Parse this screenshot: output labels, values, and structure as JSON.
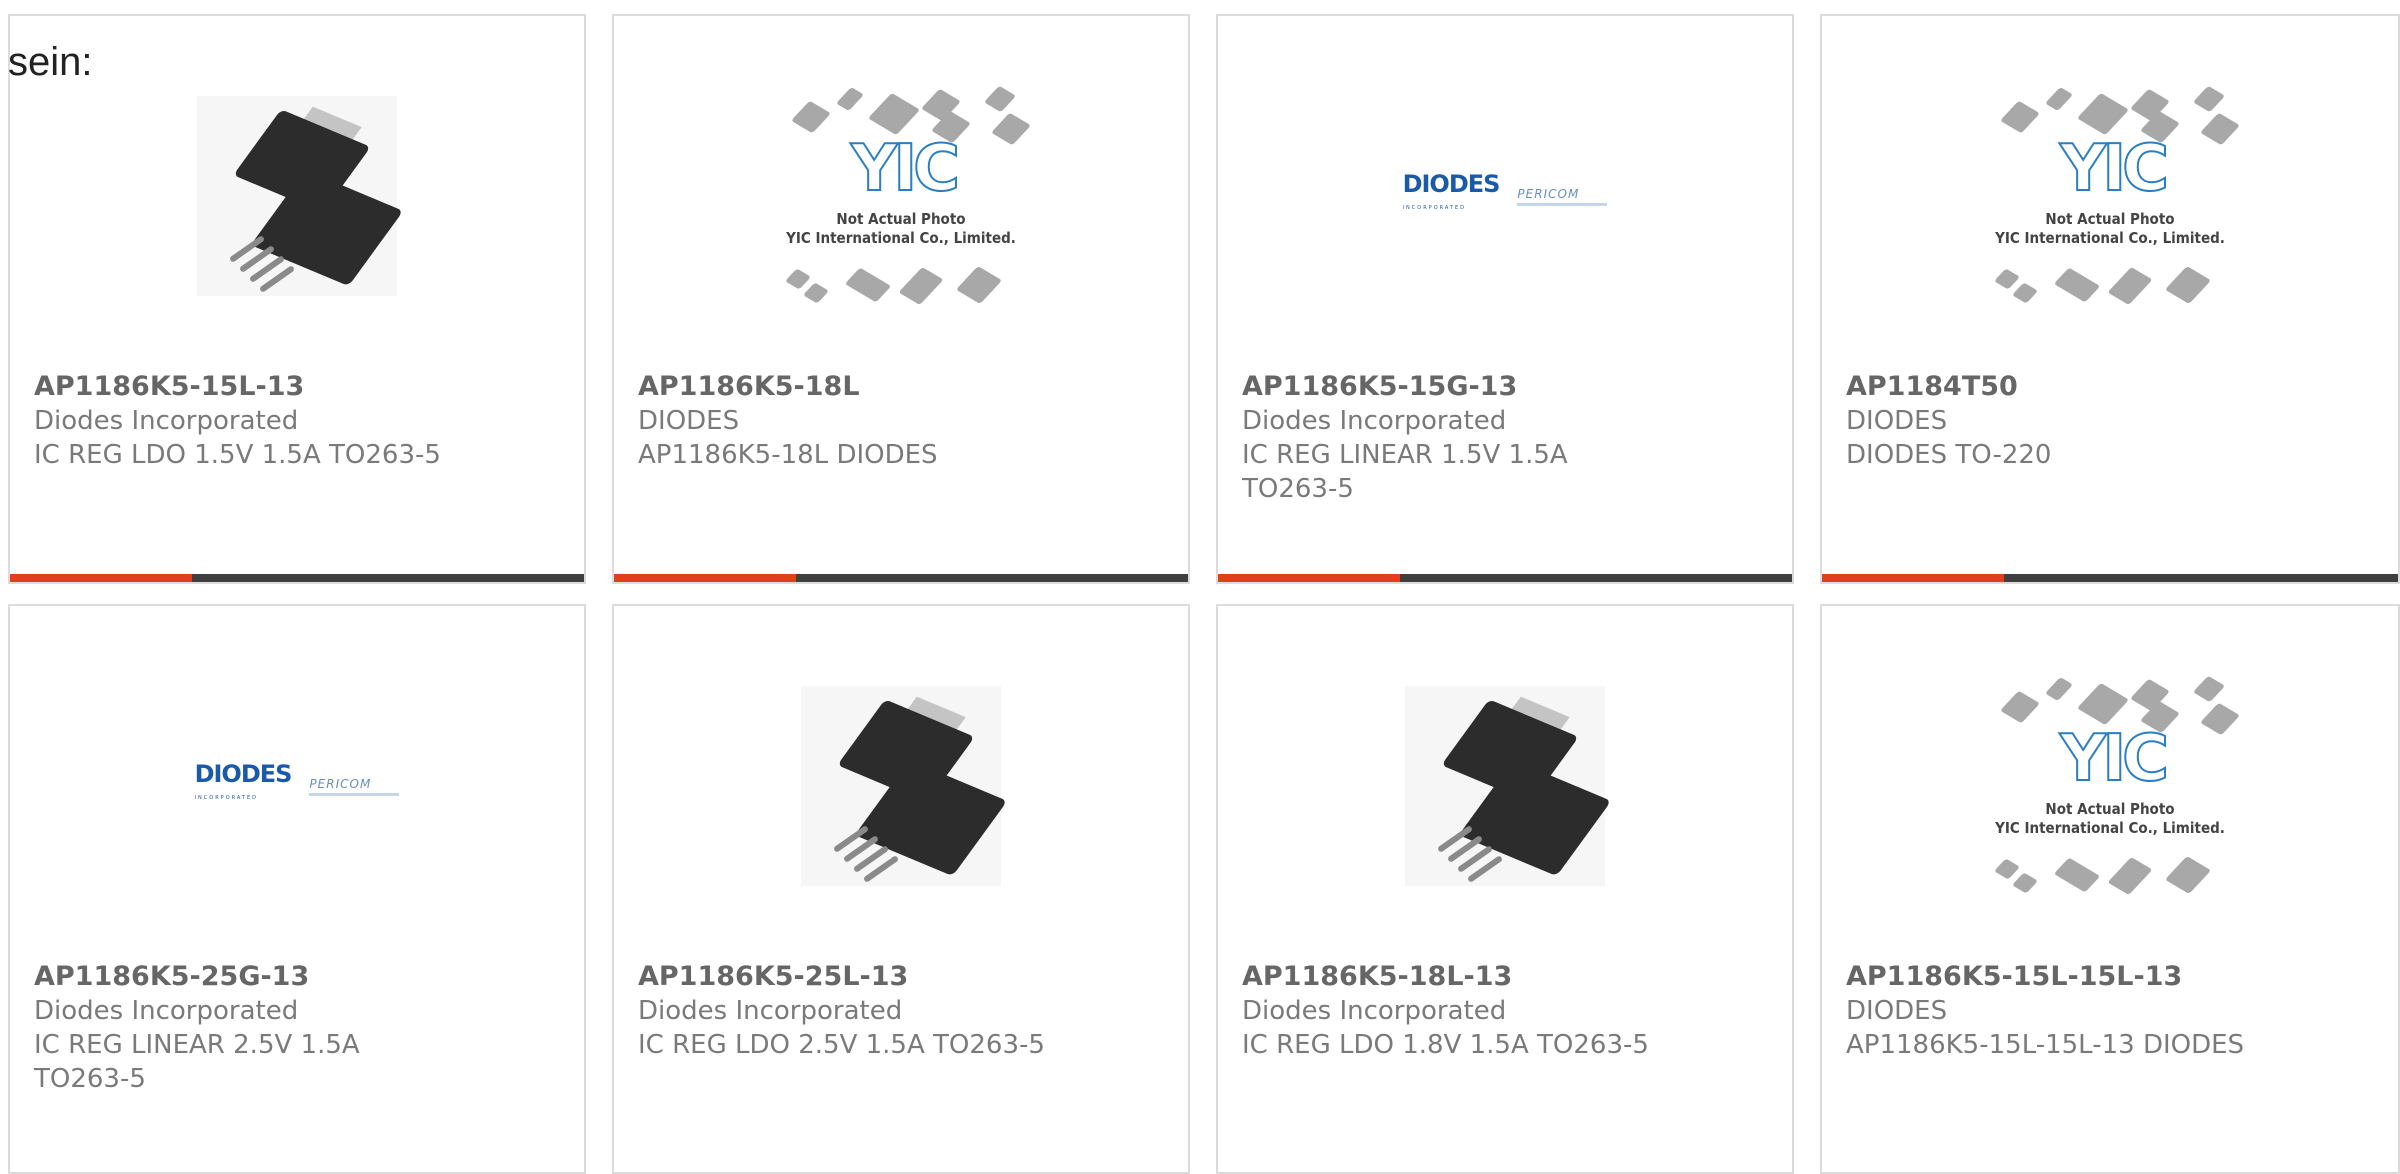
{
  "lead_text": "sein:",
  "products": [
    {
      "part": "AP1186K5-15L-13",
      "manufacturer": "Diodes Incorporated",
      "description": "IC REG LDO 1.5V 1.5A TO263-5",
      "image": "chip-package-photo"
    },
    {
      "part": "AP1186K5-18L",
      "manufacturer": "DIODES",
      "description": "AP1186K5-18L DIODES",
      "image": "yic-placeholder"
    },
    {
      "part": "AP1186K5-15G-13",
      "manufacturer": "Diodes Incorporated",
      "description": "IC REG LINEAR 1.5V 1.5A TO263-5",
      "image": "diodes-logo"
    },
    {
      "part": "AP1184T50",
      "manufacturer": "DIODES",
      "description": "DIODES TO-220",
      "image": "yic-placeholder"
    },
    {
      "part": "AP1186K5-25G-13",
      "manufacturer": "Diodes Incorporated",
      "description": "IC REG LINEAR 2.5V 1.5A TO263-5",
      "image": "diodes-logo"
    },
    {
      "part": "AP1186K5-25L-13",
      "manufacturer": "Diodes Incorporated",
      "description": "IC REG LDO 2.5V 1.5A TO263-5",
      "image": "chip-package-photo"
    },
    {
      "part": "AP1186K5-18L-13",
      "manufacturer": "Diodes Incorporated",
      "description": "IC REG LDO 1.8V 1.5A TO263-5",
      "image": "chip-package-photo"
    },
    {
      "part": "AP1186K5-15L-15L-13",
      "manufacturer": "DIODES",
      "description": "AP1186K5-15L-15L-13 DIODES",
      "image": "yic-placeholder"
    }
  ],
  "yic": {
    "logo": "YIC",
    "line1": "Not Actual Photo",
    "line2": "YIC International Co., Limited."
  },
  "diodes_logo": {
    "brand": "DIODES",
    "sub": "INCORPORATED",
    "partner": "PERICOM"
  },
  "colors": {
    "accent": "#e2401c",
    "bar": "#3f3f3f",
    "border": "#dcdcdc",
    "diodes_blue": "#1a5aa8",
    "yic_blue": "#2a7fc4"
  }
}
